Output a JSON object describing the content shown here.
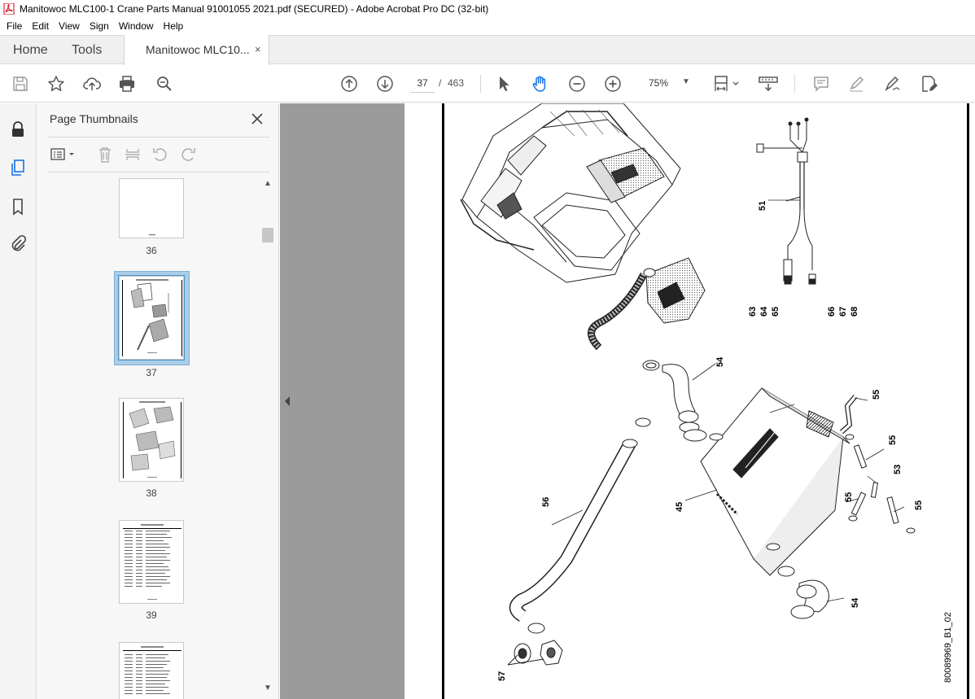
{
  "window": {
    "title": "Manitowoc MLC100-1 Crane Parts Manual 91001055 2021.pdf (SECURED) - Adobe Acrobat Pro DC (32-bit)"
  },
  "menu": [
    "File",
    "Edit",
    "View",
    "Sign",
    "Window",
    "Help"
  ],
  "tabs": {
    "home": "Home",
    "tools": "Tools",
    "document": "Manitowoc MLC10...",
    "close": "×"
  },
  "toolbar": {
    "icons": [
      "save-icon",
      "star-icon",
      "upload-icon",
      "print-icon",
      "zoom-search-icon",
      "page-up-icon",
      "page-down-icon",
      "select-arrow-icon",
      "hand-icon",
      "zoom-out-icon",
      "zoom-in-icon",
      "fit-page-icon",
      "scroll-mode-icon",
      "comment-icon",
      "highlight-icon",
      "sign-icon",
      "edit-pdf-icon"
    ],
    "current_page": "37",
    "page_sep": "/",
    "total_pages": "463",
    "zoom": "75%"
  },
  "sidebar": {
    "panel_title": "Page Thumbnails",
    "close": "×"
  },
  "thumbnails": [
    {
      "label": "36",
      "selected": false
    },
    {
      "label": "37",
      "selected": true
    },
    {
      "label": "38",
      "selected": false
    },
    {
      "label": "39",
      "selected": false
    }
  ],
  "drawing": {
    "callouts": [
      "51",
      "63",
      "64",
      "65",
      "66",
      "67",
      "68",
      "54",
      "55",
      "55",
      "53",
      "55",
      "55",
      "45",
      "56",
      "54",
      "57"
    ],
    "drawing_id": "80089969_B1_02"
  }
}
